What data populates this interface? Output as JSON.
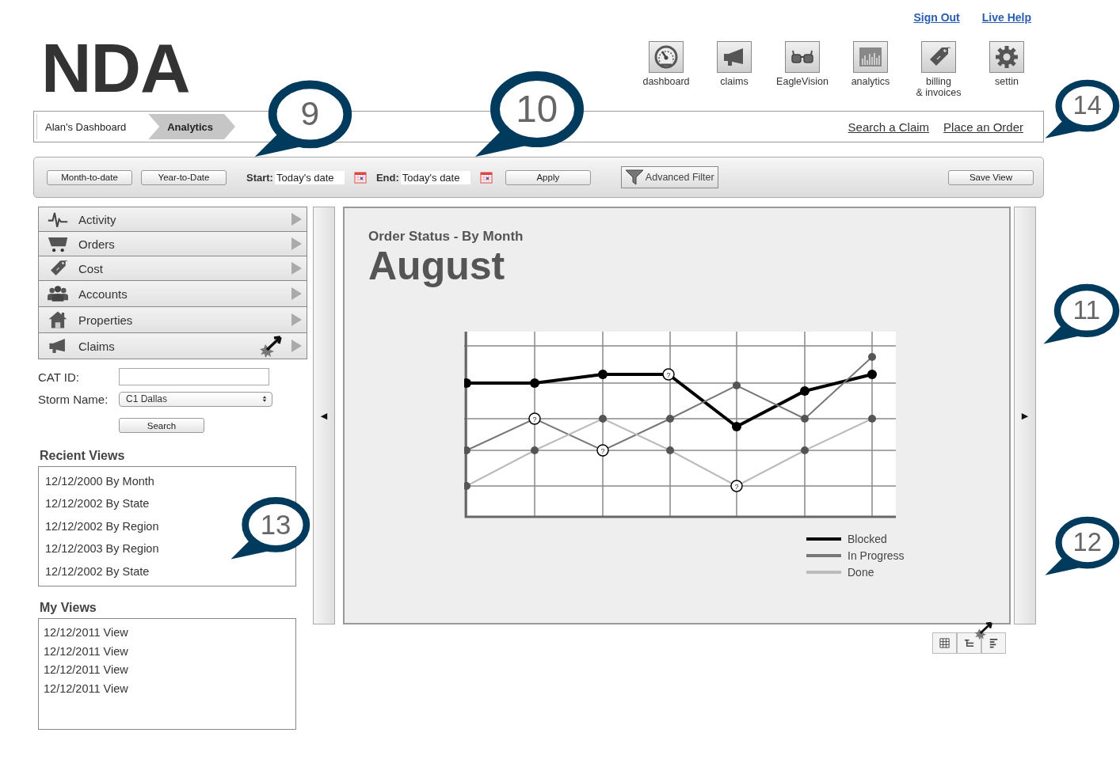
{
  "header": {
    "logo": "NDA",
    "links": [
      "Sign Out",
      "Live Help"
    ]
  },
  "nav_icons": [
    {
      "kind": "gauge",
      "label": "dashboard"
    },
    {
      "kind": "megaphone",
      "label": "claims"
    },
    {
      "kind": "glasses",
      "label": "EagleVision"
    },
    {
      "kind": "bars",
      "label": "analytics"
    },
    {
      "kind": "tag",
      "label": "billing\n& invoices"
    },
    {
      "kind": "gear",
      "label": "settin"
    }
  ],
  "breadcrumbs": [
    {
      "label": "Alan's Dashboard",
      "selected": false
    },
    {
      "label": "Analytics",
      "selected": true
    }
  ],
  "quick_links": [
    "Search a Claim",
    "Place an Order"
  ],
  "toolbar": {
    "presets": [
      "Month-to-date",
      "Year-to-Date"
    ],
    "start_label": "Start:",
    "start_value": "Today's date",
    "end_label": "End:",
    "end_value": "Today's date",
    "apply": "Apply",
    "advanced_filter": "Advanced Filter",
    "save_view": "Save View"
  },
  "menu": [
    {
      "kind": "pulse",
      "label": "Activity",
      "clicked": false
    },
    {
      "kind": "cart",
      "label": "Orders",
      "clicked": false
    },
    {
      "kind": "tag",
      "label": "Cost",
      "clicked": false
    },
    {
      "kind": "people",
      "label": "Accounts",
      "clicked": false
    },
    {
      "kind": "house",
      "label": "Properties",
      "clicked": false
    },
    {
      "kind": "megaphone",
      "label": "Claims",
      "clicked": true
    }
  ],
  "filters": {
    "cat_id_label": "CAT ID:",
    "storm_name_label": "Storm Name:",
    "storm_name_value": "C1 Dallas",
    "search": "Search"
  },
  "recent_views": {
    "title": "Recient Views",
    "items": [
      "12/12/2000 By Month",
      "12/12/2002 By State",
      "12/12/2002 By Region",
      "12/12/2003 By Region",
      "12/12/2002 By State"
    ]
  },
  "my_views": {
    "title": "My Views",
    "items": [
      "12/12/2011 View",
      "12/12/2011 View",
      "12/12/2011 View",
      "12/12/2011 View"
    ]
  },
  "collapse_left": "◀",
  "collapse_right": "▶",
  "chart_panel": {
    "subtitle": "Order Status - By Month",
    "title": "August",
    "point_marker": "?",
    "legend": [
      {
        "label": "Blocked",
        "color": "#000000"
      },
      {
        "label": "In Progress",
        "color": "#777777"
      },
      {
        "label": "Done",
        "color": "#bbbbbb"
      }
    ]
  },
  "view_toggles": [
    {
      "kind": "grid",
      "clicked": false
    },
    {
      "kind": "tree",
      "clicked": true
    },
    {
      "kind": "list",
      "clicked": false
    }
  ],
  "callouts": [
    {
      "number": "9"
    },
    {
      "number": "10"
    },
    {
      "number": "14"
    },
    {
      "number": "11"
    },
    {
      "number": "12"
    },
    {
      "number": "13"
    }
  ]
}
